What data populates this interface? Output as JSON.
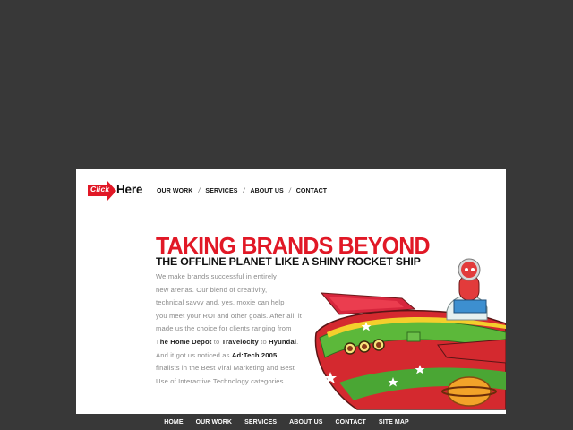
{
  "logo": {
    "click": "Click",
    "here": "Here"
  },
  "top_nav": {
    "items": [
      "OUR WORK",
      "SERVICES",
      "ABOUT US",
      "CONTACT"
    ],
    "separator": "/"
  },
  "hero": {
    "headline": "TAKING BRANDS BEYOND",
    "subheadline": "THE OFFLINE PLANET LIKE A SHINY ROCKET SHIP"
  },
  "copy": {
    "l1": "We make brands successful in entirely",
    "l2": "new arenas. Our blend of creativity,",
    "l3": "technical savvy and, yes, moxie can help",
    "l4": "you meet your ROI and other goals. After all, it",
    "l5": "made us the choice for clients ranging from",
    "client1": "The Home Depot",
    "to1": " to ",
    "client2": "Travelocity",
    "to2": " to ",
    "client3": "Hyundai",
    "period1": ".",
    "l7a": "And it got us noticed as ",
    "award": "Ad:Tech 2005",
    "l8": "finalists in the Best Viral Marketing and Best",
    "l9": "Use of Interactive Technology categories."
  },
  "footer_nav": [
    "HOME",
    "OUR WORK",
    "SERVICES",
    "ABOUT US",
    "CONTACT",
    "SITE MAP"
  ],
  "colors": {
    "background": "#383838",
    "brand_red": "#e11826",
    "panel": "#ffffff"
  },
  "illustration": "toy-rocket-ship-with-robot-pilot"
}
